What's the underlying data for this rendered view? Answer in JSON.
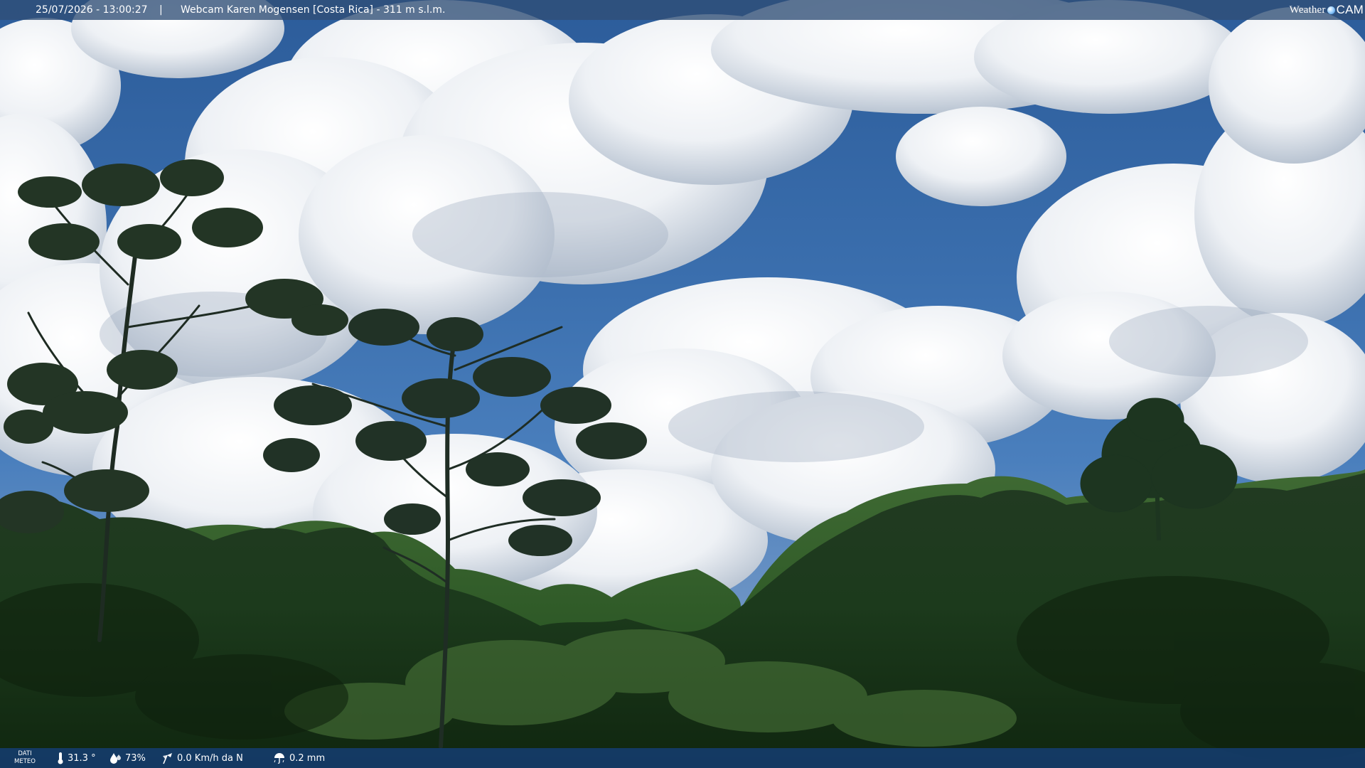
{
  "top_bar": {
    "datetime": "25/07/2026 - 13:00:27",
    "separator": "|",
    "title": "Webcam Karen Mogensen [Costa Rica]  - 311 m s.l.m.",
    "brand_left": "Weather",
    "brand_right": "CAM"
  },
  "bottom_bar": {
    "label_line1": "DATI",
    "label_line2": "METEO",
    "temperature": "31.3 °",
    "humidity": "73%",
    "wind": "0.0 Km/h da N",
    "rain": "0.2 mm"
  },
  "icons": {
    "temperature": "thermometer-icon",
    "humidity": "humidity-drop-icon",
    "wind": "wind-icon",
    "rain": "rain-umbrella-icon",
    "brand": "globe-icon"
  }
}
